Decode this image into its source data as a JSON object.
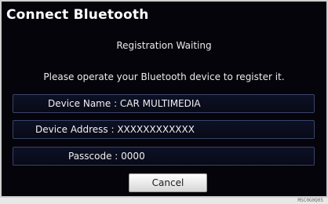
{
  "dialog": {
    "title": "Connect Bluetooth",
    "status": "Registration Waiting",
    "instruction": "Please operate your Bluetooth device to register it.",
    "device_name": "Device Name : CAR MULTIMEDIA",
    "device_address": "Device Address : XXXXXXXXXXXX",
    "passcode": "Passcode : 0000",
    "cancel_label": "Cancel"
  },
  "figure_code": "MSC0G0Q05"
}
